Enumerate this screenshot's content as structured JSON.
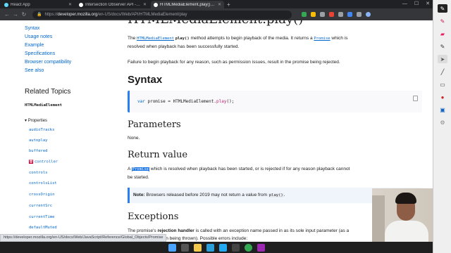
{
  "browser": {
    "tabs": [
      {
        "title": "React App",
        "active": false,
        "favicon_color": "#61dafb"
      },
      {
        "title": "Intersection Observer API - Web",
        "active": false,
        "favicon_color": "#ffffff"
      },
      {
        "title": "HTMLMediaElement.play() - Web",
        "active": true,
        "favicon_color": "#ffffff"
      }
    ],
    "new_tab": "+",
    "url_prefix": "https://",
    "url_host": "developer.mozilla.org",
    "url_path": "/en-US/docs/Web/API/HTMLMediaElement/play",
    "status_url": "https://developer.mozilla.org/en-US/docs/Web/JavaScript/Reference/Global_Objects/Promise"
  },
  "sidebar": {
    "section_links": [
      "Syntax",
      "Usage notes",
      "Example",
      "Specifications",
      "Browser compatibility",
      "See also"
    ],
    "related_title": "Related Topics",
    "related_link": "HTMLMediaElement",
    "properties_heading": "Properties",
    "properties": [
      {
        "name": "audioTracks",
        "deprecated": false
      },
      {
        "name": "autoplay",
        "deprecated": false
      },
      {
        "name": "buffered",
        "deprecated": false
      },
      {
        "name": "controller",
        "deprecated": true
      },
      {
        "name": "controls",
        "deprecated": false
      },
      {
        "name": "controlsList",
        "deprecated": false
      },
      {
        "name": "crossOrigin",
        "deprecated": false
      },
      {
        "name": "currentSrc",
        "deprecated": false
      },
      {
        "name": "currentTime",
        "deprecated": false
      },
      {
        "name": "defaultMuted",
        "deprecated": false
      }
    ]
  },
  "main": {
    "title": "HTMLMediaElement.play()",
    "intro_the": "The",
    "intro_link": "HTMLMediaElement",
    "intro_method": "play()",
    "intro_mid": "method attempts to begin playback of the media. It returns a",
    "intro_promise": "Promise",
    "intro_end": "which is resolved when playback has been successfully started.",
    "failure_text": "Failure to begin playback for any reason, such as permission issues, result in the promise being rejected.",
    "syntax_heading": "Syntax",
    "code_kw": "var",
    "code_mid": "promise = HTMLMediaElement.",
    "code_fn": "play",
    "code_end": "();",
    "parameters_heading": "Parameters",
    "parameters_text": "None.",
    "return_heading": "Return value",
    "return_a": "A",
    "return_promise": "Promise",
    "return_text": "which is resolved when playback has been started, or is rejected if for any reason playback",
    "return_text2": "cannot be started.",
    "note_label": "Note:",
    "note_text": "Browsers released before 2019 may not return a value from",
    "note_code": "play()",
    "note_end": ".",
    "exceptions_heading": "Exceptions",
    "exceptions_pre": "The promise's",
    "exceptions_bold": "rejection handler",
    "exceptions_post": "is called with an exception name passed in as its sole input parameter (as",
    "exceptions_line2": "a traditional exception being thrown). Possible errors include:"
  },
  "icons": {
    "back": "back-arrow-icon",
    "forward": "forward-arrow-icon",
    "reload": "reload-icon",
    "lock": "lock-icon",
    "copy": "copy-icon"
  }
}
